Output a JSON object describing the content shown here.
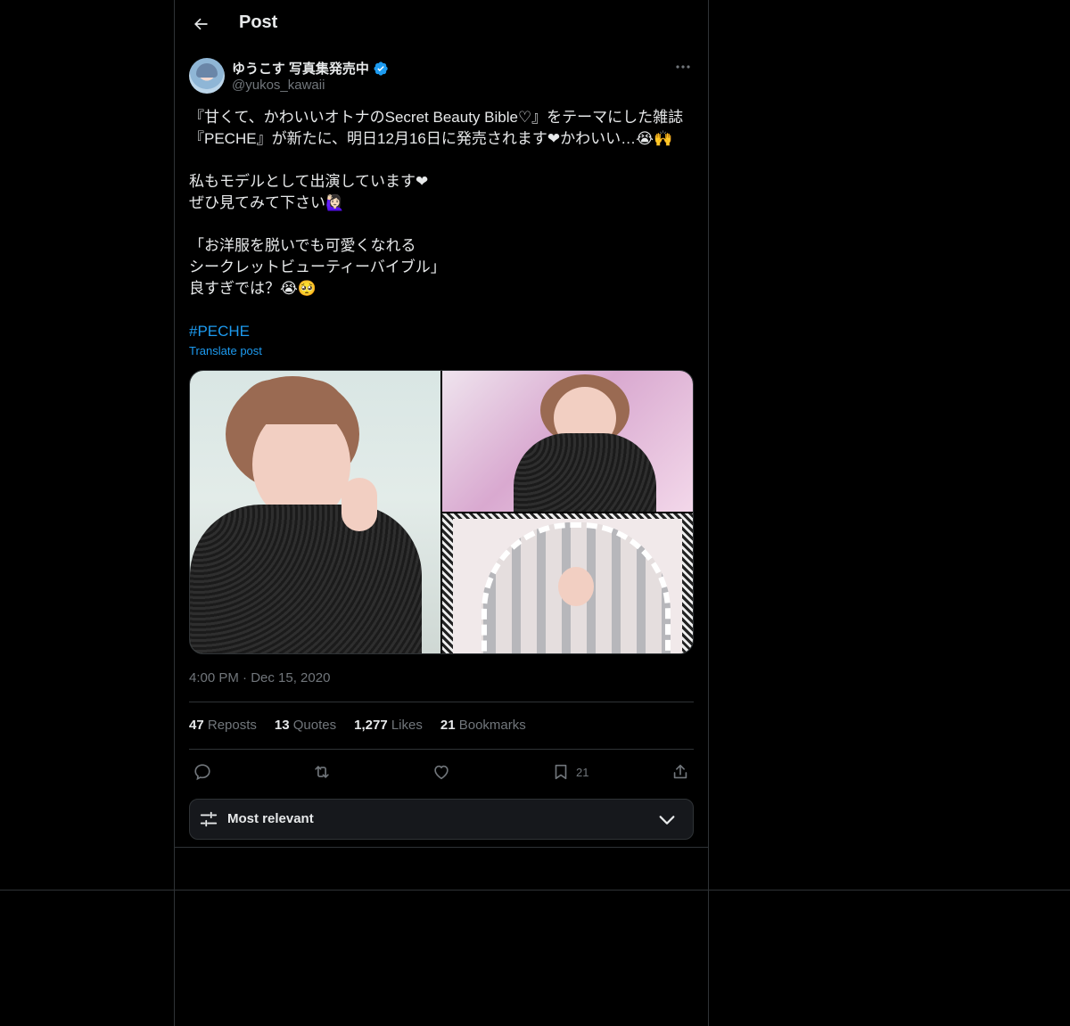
{
  "header": {
    "title": "Post"
  },
  "author": {
    "display_name": "ゆうこす 写真集発売中",
    "handle": "@yukos_kawaii",
    "verified": true
  },
  "tweet": {
    "lines": [
      "『甘くて、かわいいオトナのSecret Beauty Bible♡』をテーマにした雑誌",
      "『PECHE』が新たに、明日12月16日に発売されます❤かわいい…😭🙌",
      "",
      "私もモデルとして出演しています❤",
      "ぜひ見てみて下さい🙋🏻‍♀️",
      "",
      "「お洋服を脱いでも可愛くなれる",
      "シークレットビューティーバイブル」",
      "良すぎでは？😭🥺",
      ""
    ],
    "hashtag": "#PECHE",
    "translate_label": "Translate post",
    "timestamp": "4:00 PM · Dec 15, 2020"
  },
  "stats": {
    "reposts_count": "47",
    "reposts_label": "Reposts",
    "quotes_count": "13",
    "quotes_label": "Quotes",
    "likes_count": "1,277",
    "likes_label": "Likes",
    "bookmarks_count": "21",
    "bookmarks_label": "Bookmarks"
  },
  "actions": {
    "bookmark_count": "21"
  },
  "sort": {
    "label": "Most relevant"
  },
  "colors": {
    "background": "#000000",
    "text": "#e7e9ea",
    "muted": "#71767b",
    "accent": "#1d9bf0",
    "border": "#2f3336"
  }
}
